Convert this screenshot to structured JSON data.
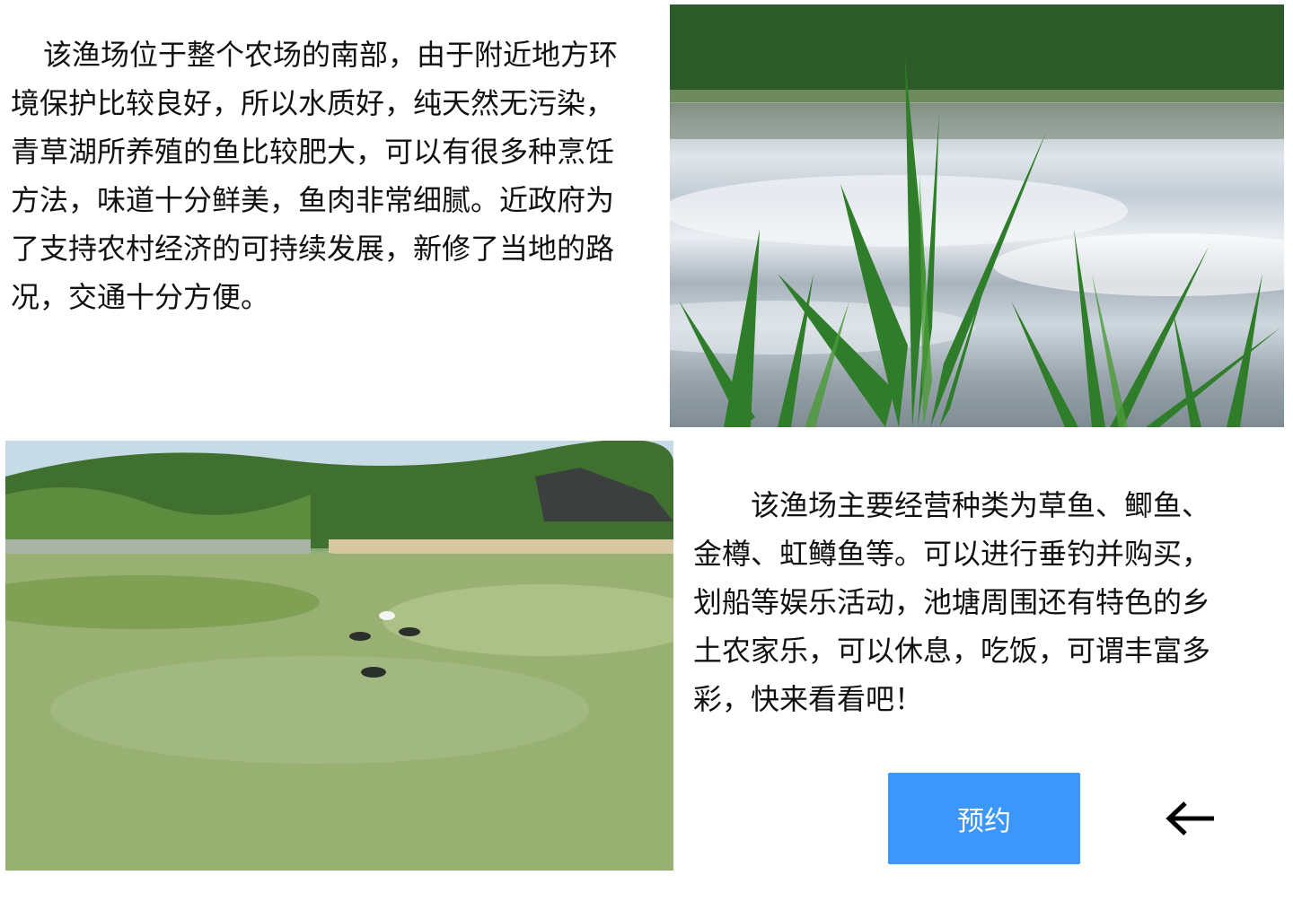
{
  "sections": {
    "intro_text": "该渔场位于整个农场的南部，由于附近地方环境保护比较良好，所以水质好，纯天然无污染，青草湖所养殖的鱼比较肥大，可以有很多种烹饪方法，味道十分鲜美，鱼肉非常细腻。近政府为了支持农村经济的可持续发展，新修了当地的路况，交通十分方便。",
    "species_text": "该渔场主要经营种类为草鱼、鲫鱼、金樽、虹鳟鱼等。可以进行垂钓并购买，划船等娱乐活动，池塘周围还有特色的乡土农家乐，可以休息，吃饭，可谓丰富多彩，快来看看吧！"
  },
  "actions": {
    "book_label": "预约",
    "back_icon": "arrow-left-icon"
  },
  "colors": {
    "button_bg": "#3d97fb",
    "button_text": "#ffffff",
    "text": "#111111"
  }
}
